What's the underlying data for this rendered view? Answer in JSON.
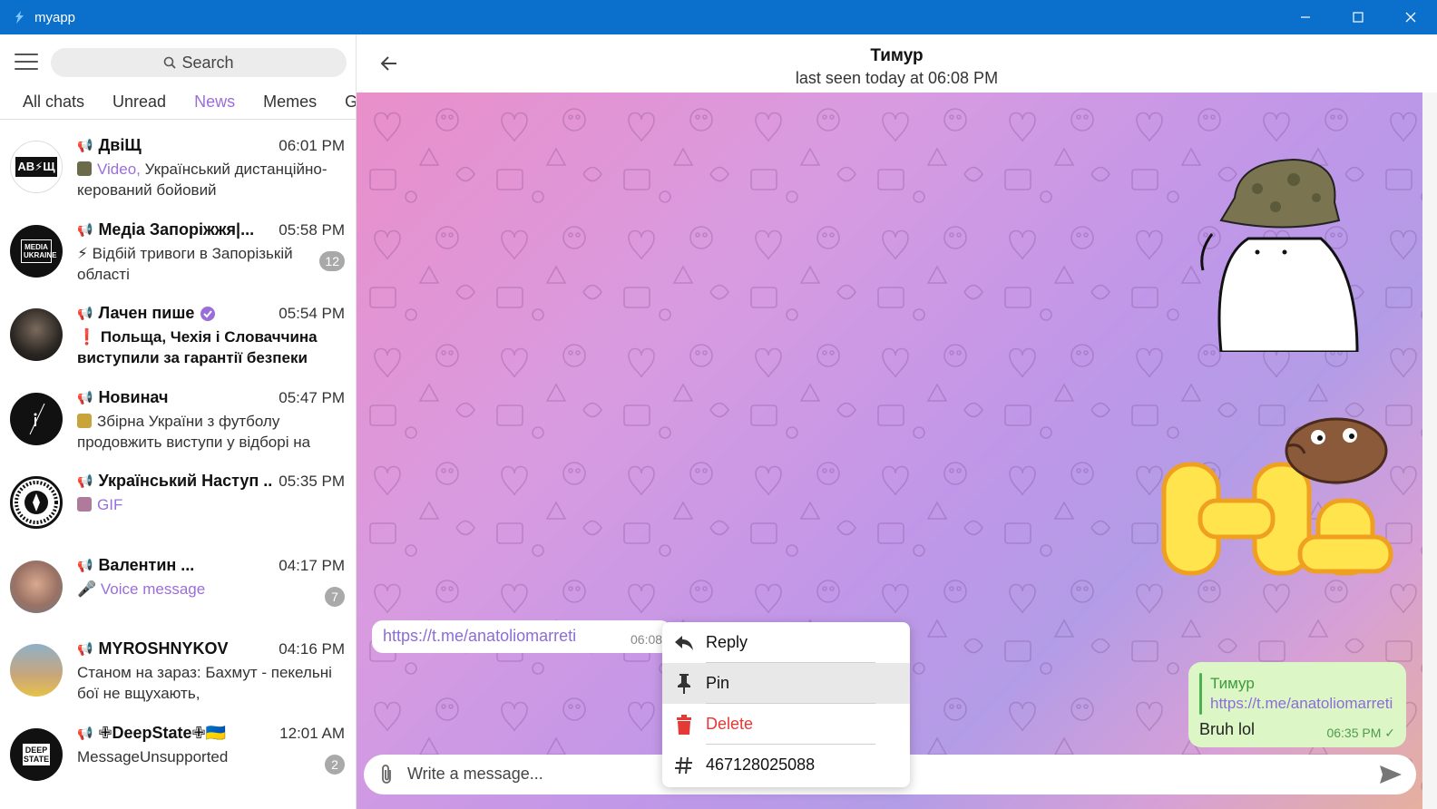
{
  "window": {
    "title": "myapp"
  },
  "sidebar": {
    "search_label": "Search",
    "tabs": [
      "All chats",
      "Unread",
      "News",
      "Memes",
      "G"
    ],
    "active_tab": "News",
    "chats": [
      {
        "name": "ДвіЩ",
        "time": "06:01 PM",
        "preview_accent": "Video,",
        "preview": " Український дистанційно-керований бойовий",
        "badge": ""
      },
      {
        "name": "Медіа Запоріжжя|...",
        "time": "05:58 PM",
        "preview": "⚡ Відбій тривоги в Запорізькій області",
        "badge": "12"
      },
      {
        "name": "Лачен пише",
        "time": "05:54 PM",
        "preview": "❗ Польща, Чехія і Словаччина виступили за гарантії безпеки",
        "badge": ""
      },
      {
        "name": "Новинач",
        "time": "05:47 PM",
        "preview": "Збірна України з футболу продовжить виступи у відборі на",
        "badge": ""
      },
      {
        "name": "Український Наступ ...",
        "time": "05:35 PM",
        "preview_accent": "GIF",
        "badge": ""
      },
      {
        "name": "Валентин ...",
        "time": "04:17 PM",
        "preview": "🎤 ",
        "preview_accent": "Voice message",
        "badge": "7"
      },
      {
        "name": "MYROSHNYKOV",
        "time": "04:16 PM",
        "preview": "Станом на зараз:  Бахмут - пекельні бої не вщухають,",
        "badge": ""
      },
      {
        "name": "✙DeepState✙🇺🇦",
        "time": "12:01 AM",
        "preview": "MessageUnsupported",
        "badge": "2"
      }
    ],
    "avatar_labels": {
      "dvishch": "AB⚡Щ",
      "media": "MEDIA UKRAINE",
      "deepstate": "DEEP STATE"
    }
  },
  "chat": {
    "name": "Тимур",
    "status": "last seen today at 06:08 PM",
    "incoming": {
      "link": "https://t.me/anatoliomarreti",
      "time": "06:08"
    },
    "outgoing": {
      "reply_name": "Тимур",
      "reply_link": "https://t.me/anatoliomarreti",
      "text": "Bruh lol",
      "time": "06:35 PM ✓"
    },
    "input_placeholder": "Write a message..."
  },
  "context_menu": {
    "items": [
      {
        "label": "Reply",
        "icon": "reply-icon"
      },
      {
        "label": "Pin",
        "icon": "pin-icon"
      },
      {
        "label": "Delete",
        "icon": "trash-icon"
      },
      {
        "label": "467128025088",
        "icon": "hash-icon"
      }
    ]
  },
  "colors": {
    "accent": "#9a6ed8",
    "titlebar": "#0b6fcc",
    "danger": "#e53935",
    "outgoing_bubble": "#dcf7c5"
  }
}
